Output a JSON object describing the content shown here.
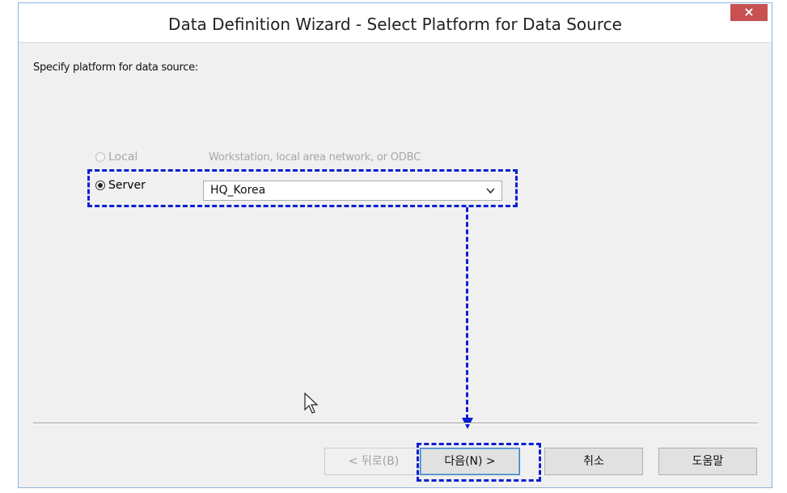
{
  "window": {
    "title": "Data Definition Wizard - Select Platform for Data Source",
    "close_label": "×"
  },
  "prompt": "Specify platform for data source:",
  "options": {
    "local": {
      "label": "Local",
      "description": "Workstation, local area network, or ODBC",
      "enabled": false,
      "selected": false
    },
    "server": {
      "label": "Server",
      "enabled": true,
      "selected": true
    }
  },
  "server_select": {
    "value": "HQ_Korea"
  },
  "buttons": {
    "back": "< 뒤로(B)",
    "next": "다음(N) >",
    "cancel": "취소",
    "help": "도움말"
  },
  "colors": {
    "annotation": "#0a1fd1",
    "close_button": "#c75050",
    "dialog_background": "#f0f0f0"
  }
}
